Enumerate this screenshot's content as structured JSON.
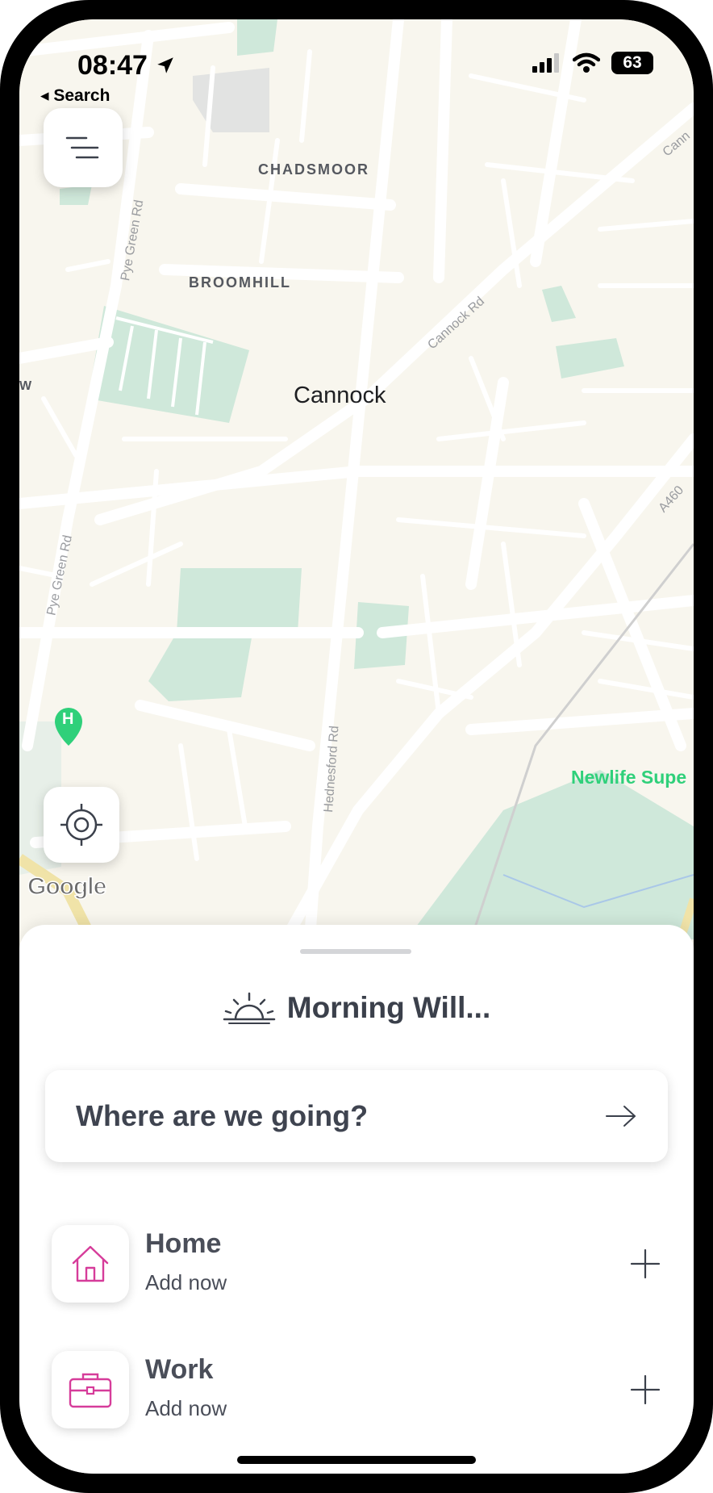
{
  "status_bar": {
    "time": "08:47",
    "back_label": "◂ Search",
    "battery": "63"
  },
  "map": {
    "areas": [
      "CHADSMOOR",
      "BROOMHILL"
    ],
    "city": "Cannock",
    "roads": {
      "pye_green_top": "Pye Green Rd",
      "pye_green_bottom": "Pye Green Rd",
      "cannock_rd": "Cannock Rd",
      "cannock_top": "Cann",
      "hednesford_rd": "Hednesford Rd",
      "a460": "A460",
      "edge_w": "W"
    },
    "poi": "Newlife Supe",
    "hospital_marker": "H",
    "attribution": "Google"
  },
  "sheet": {
    "greeting": "Morning Will...",
    "search_placeholder": "Where are we going?",
    "places": [
      {
        "title": "Home",
        "subtitle": "Add now"
      },
      {
        "title": "Work",
        "subtitle": "Add now"
      }
    ]
  },
  "colors": {
    "accent_icon": "#d63c9a",
    "poi_green": "#2fd07a",
    "park_green": "#cfe8da",
    "map_bg": "#f8f6ee"
  },
  "icons": [
    "location-arrow-icon",
    "signal-icon",
    "wifi-icon",
    "battery-icon",
    "menu-icon",
    "locate-icon",
    "sunrise-icon",
    "arrow-right-icon",
    "home-icon",
    "briefcase-icon",
    "plus-icon",
    "hospital-icon"
  ]
}
